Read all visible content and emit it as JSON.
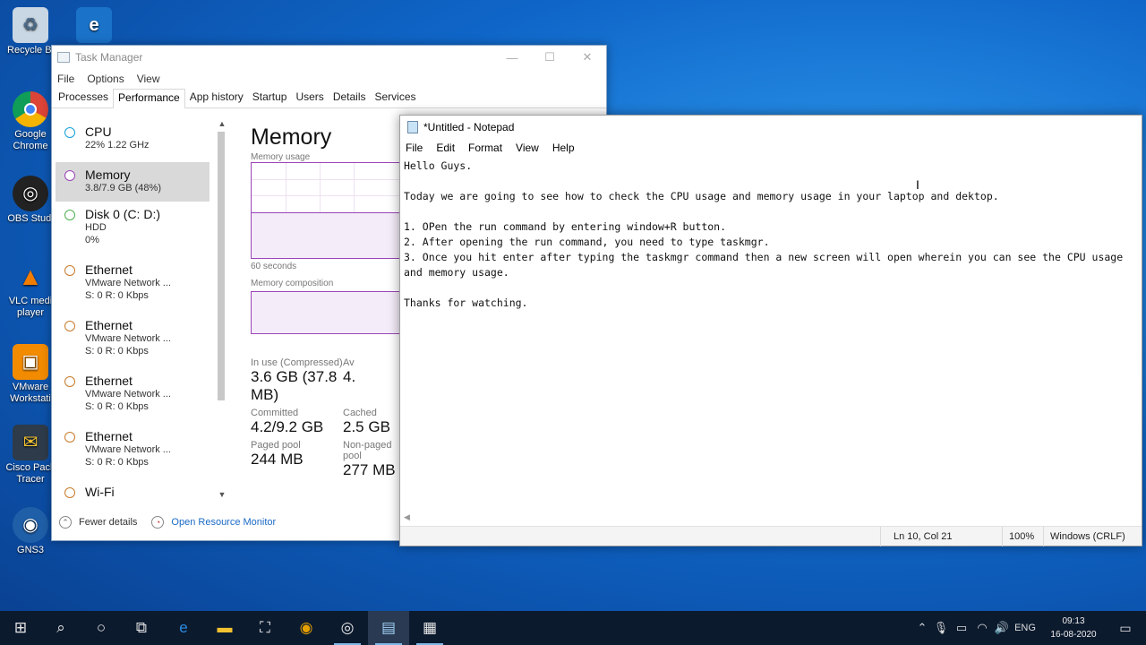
{
  "desktop": {
    "icons": [
      {
        "label": "Recycle Bi",
        "icon": "recycle-bin-icon"
      },
      {
        "label": "",
        "icon": "edge-icon"
      },
      {
        "label": "Google Chrome",
        "icon": "chrome-icon"
      },
      {
        "label": "OBS Studi",
        "icon": "obs-icon"
      },
      {
        "label": "VLC medi player",
        "icon": "vlc-icon"
      },
      {
        "label": "VMware Workstati",
        "icon": "vmware-icon"
      },
      {
        "label": "Cisco Pack Tracer",
        "icon": "cisco-icon"
      },
      {
        "label": "GNS3",
        "icon": "gns3-icon"
      }
    ]
  },
  "task_manager": {
    "title": "Task Manager",
    "menu": [
      "File",
      "Options",
      "View"
    ],
    "tabs": [
      "Processes",
      "Performance",
      "App history",
      "Startup",
      "Users",
      "Details",
      "Services"
    ],
    "active_tab": "Performance",
    "sidebar": [
      {
        "name": "CPU",
        "sub1": "22%  1.22 GHz",
        "sub2": "",
        "color": "#17a0d8"
      },
      {
        "name": "Memory",
        "sub1": "3.8/7.9 GB (48%)",
        "sub2": "",
        "color": "#9b45b8"
      },
      {
        "name": "Disk 0 (C: D:)",
        "sub1": "HDD",
        "sub2": "0%",
        "color": "#4caf50"
      },
      {
        "name": "Ethernet",
        "sub1": "VMware Network ...",
        "sub2": "S: 0  R: 0 Kbps",
        "color": "#c77b2c"
      },
      {
        "name": "Ethernet",
        "sub1": "VMware Network ...",
        "sub2": "S: 0  R: 0 Kbps",
        "color": "#c77b2c"
      },
      {
        "name": "Ethernet",
        "sub1": "VMware Network ...",
        "sub2": "S: 0  R: 0 Kbps",
        "color": "#c77b2c"
      },
      {
        "name": "Ethernet",
        "sub1": "VMware Network ...",
        "sub2": "S: 0  R: 0 Kbps",
        "color": "#c77b2c"
      },
      {
        "name": "Wi-Fi",
        "sub1": "",
        "sub2": "",
        "color": "#c77b2c"
      }
    ],
    "main": {
      "heading": "Memory",
      "usage_label": "Memory usage",
      "axis_label": "60 seconds",
      "composition_label": "Memory composition",
      "usage_fill_fraction": 0.48,
      "stats": [
        {
          "key": "In use (Compressed)",
          "value": "3.6 GB (37.8 MB)"
        },
        {
          "key": "Av",
          "value": "4."
        },
        {
          "key": "Committed",
          "value": "4.2/9.2 GB"
        },
        {
          "key": "Cached",
          "value": "2.5 GB"
        },
        {
          "key": "Paged pool",
          "value": "244 MB"
        },
        {
          "key": "Non-paged pool",
          "value": "277 MB"
        }
      ]
    },
    "footer": {
      "fewer_details": "Fewer details",
      "resource_monitor": "Open Resource Monitor"
    }
  },
  "notepad": {
    "title": "*Untitled - Notepad",
    "menu": [
      "File",
      "Edit",
      "Format",
      "View",
      "Help"
    ],
    "text": "Hello Guys.\n\nToday we are going to see how to check the CPU usage and memory usage in your laptop and dektop.\n\n1. OPen the run command by entering window+R button.\n2. After opening the run command, you need to type taskmgr.\n3. Once you hit enter after typing the taskmgr command then a new screen will open wherein you can see the CPU usage and memory usage.\n\nThanks for watching.",
    "status": {
      "position": "Ln 10, Col 21",
      "zoom": "100%",
      "line_ending": "Windows (CRLF)"
    }
  },
  "taskbar": {
    "language": "ENG",
    "time": "09:13",
    "date": "16-08-2020"
  }
}
